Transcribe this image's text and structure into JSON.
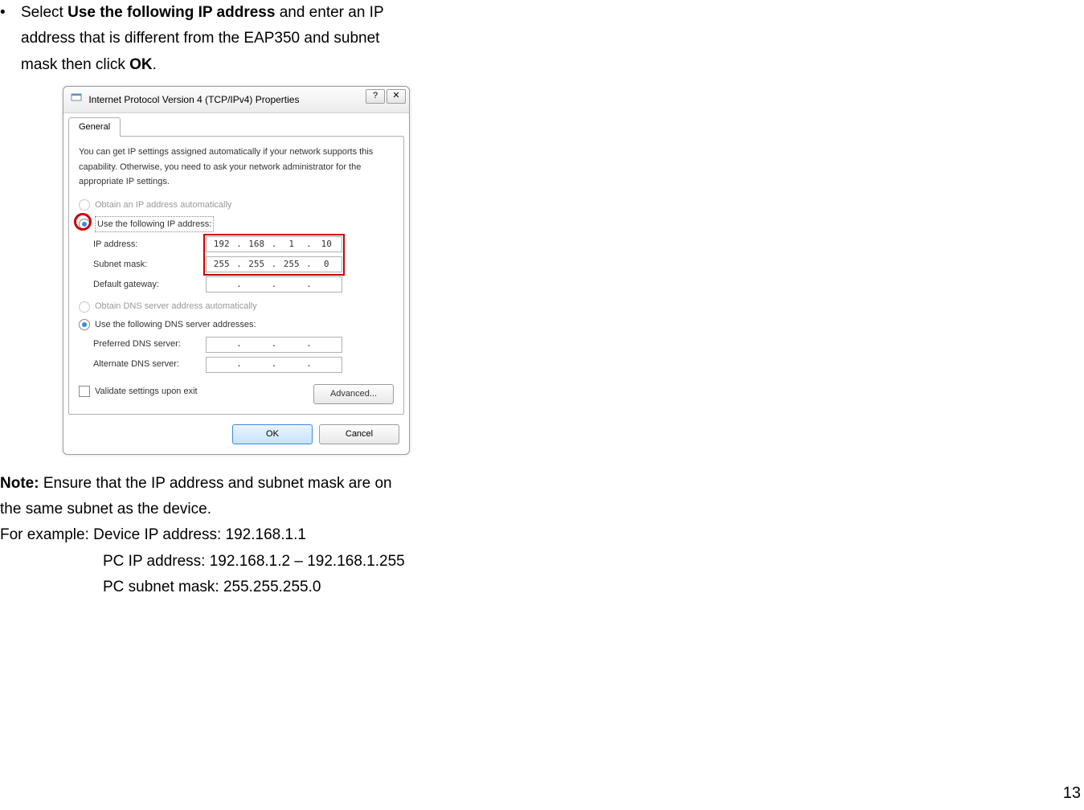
{
  "instructions": {
    "prefix": "Select ",
    "bold1": "Use the following IP address",
    "mid1": " and enter an IP",
    "line2": "address that is different from the EAP350 and subnet",
    "line3a": "mask then click ",
    "bold_ok": "OK",
    "line3b": "."
  },
  "dialog": {
    "title": "Internet Protocol Version 4 (TCP/IPv4) Properties",
    "help_glyph": "?",
    "close_glyph": "✕",
    "tab": "General",
    "desc": "You can get IP settings assigned automatically if your network supports this capability. Otherwise, you need to ask your network administrator for the appropriate IP settings.",
    "radio_auto_ip": "Obtain an IP address automatically",
    "radio_use_ip": "Use the following IP address:",
    "ip_label": "IP address:",
    "ip_value": [
      "192",
      "168",
      "1",
      "10"
    ],
    "subnet_label": "Subnet mask:",
    "subnet_value": [
      "255",
      "255",
      "255",
      "0"
    ],
    "gateway_label": "Default gateway:",
    "radio_auto_dns": "Obtain DNS server address automatically",
    "radio_use_dns": "Use the following DNS server addresses:",
    "pref_dns_label": "Preferred DNS server:",
    "alt_dns_label": "Alternate DNS server:",
    "validate_label": "Validate settings upon exit",
    "advanced_label": "Advanced...",
    "ok_label": "OK",
    "cancel_label": "Cancel"
  },
  "note": {
    "bold": "Note:",
    "line1_rest": " Ensure that the IP address and subnet mask are on",
    "line2": "the same subnet as the device.",
    "line3": "For example: Device IP address: 192.168.1.1",
    "line4": "PC IP address: 192.168.1.2 – 192.168.1.255",
    "line5": "PC subnet mask: 255.255.255.0"
  },
  "page_number": "13"
}
